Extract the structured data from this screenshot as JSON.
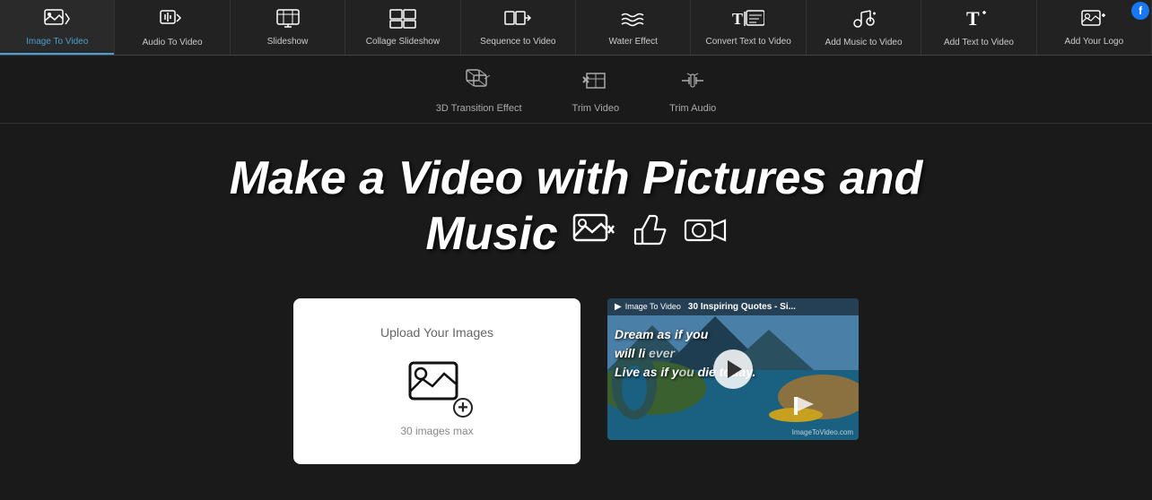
{
  "nav": {
    "items": [
      {
        "id": "image-to-video",
        "label": "Image To Video",
        "icon": "🖼️",
        "active": true
      },
      {
        "id": "audio-to-video",
        "label": "Audio To Video",
        "icon": "🎵",
        "active": false
      },
      {
        "id": "slideshow",
        "label": "Slideshow",
        "icon": "📊",
        "active": false
      },
      {
        "id": "collage-slideshow",
        "label": "Collage Slideshow",
        "icon": "🎛️",
        "active": false
      },
      {
        "id": "sequence-to-video",
        "label": "Sequence to Video",
        "icon": "🎬",
        "active": false
      },
      {
        "id": "water-effect",
        "label": "Water Effect",
        "icon": "〰️",
        "active": false
      },
      {
        "id": "convert-text-to-video",
        "label": "Convert Text to Video",
        "icon": "🔤",
        "active": false
      },
      {
        "id": "add-music-to-video",
        "label": "Add Music to Video",
        "icon": "🎤",
        "active": false
      },
      {
        "id": "add-text-to-video",
        "label": "Add Text to Video",
        "icon": "T+",
        "active": false
      },
      {
        "id": "add-your-logo",
        "label": "Add Your Logo",
        "icon": "🖼️",
        "active": false
      }
    ]
  },
  "secondary_nav": {
    "items": [
      {
        "id": "3d-transition",
        "label": "3D Transition Effect",
        "icon": "✦",
        "active": false
      },
      {
        "id": "trim-video",
        "label": "Trim Video",
        "icon": "✂",
        "active": false
      },
      {
        "id": "trim-audio",
        "label": "Trim Audio",
        "icon": "♪",
        "active": false
      }
    ]
  },
  "headline": {
    "line1": "Make a Video with Pictures and",
    "line2": "Music"
  },
  "upload_box": {
    "label": "Upload Your Images",
    "max_text": "30 images max"
  },
  "video_preview": {
    "top_label": "Image To Video",
    "title": "30 Inspiring Quotes - Si...",
    "quote_line1": "Dream as if you",
    "quote_line2": "will li",
    "quote_line3": "Live as if y",
    "quote_line4": "die today.",
    "watermark": "ImageToVideo.com"
  }
}
